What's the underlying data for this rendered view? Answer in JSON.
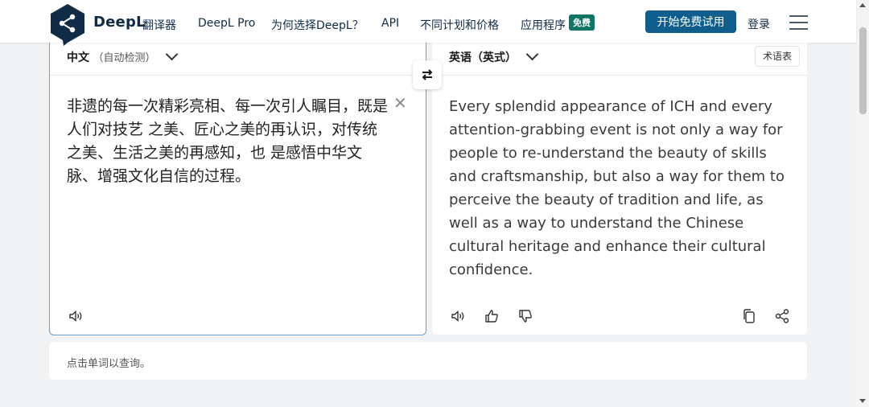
{
  "header": {
    "brand": "DeepL",
    "brand_sub": "翻译器",
    "nav": [
      "DeepL Pro",
      "为何选择DeepL？",
      "API",
      "不同计划和价格",
      "应用程序"
    ],
    "badge": "免费",
    "cta": "开始免费试用",
    "login": "登录"
  },
  "source": {
    "language": "中文",
    "detect": "（自动检测）",
    "text": "非遗的每一次精彩亮相、每一次引人瞩目，既是人们对技艺 之美、匠心之美的再认识，对传统之美、生活之美的再感知，也 是感悟中华文脉、增强文化自信的过程。"
  },
  "target": {
    "language": "英语（英式）",
    "glossary": "术语表",
    "text": "Every splendid appearance of ICH and every attention-grabbing event is not only a way for people to re-understand the beauty of skills and craftsmanship, but also a way for them to perceive the beauty of tradition and life, as well as a way to understand the Chinese cultural heritage and enhance their cultural confidence."
  },
  "dictionary": {
    "hint": "点击单词以查询。"
  },
  "colors": {
    "brand": "#0f2b46",
    "cta": "#0f5e8d",
    "badge": "#0f7564",
    "source_border": "#6aa0c8"
  }
}
